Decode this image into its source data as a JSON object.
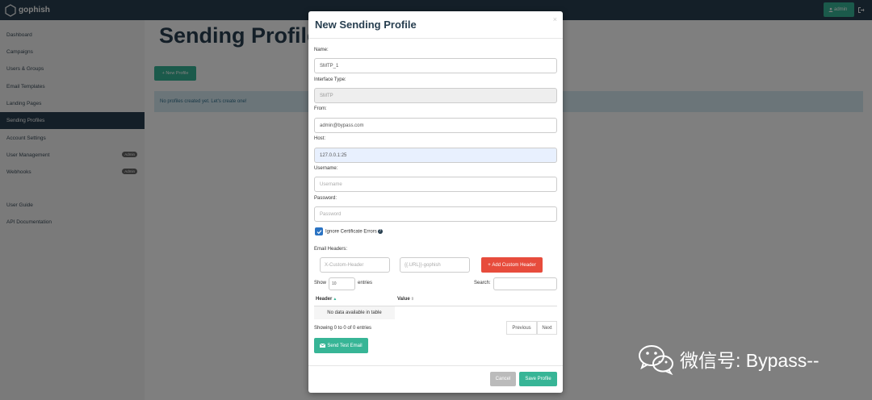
{
  "app": {
    "name": "gophish"
  },
  "header": {
    "user_label": "admin"
  },
  "sidebar": {
    "items": [
      {
        "label": "Dashboard"
      },
      {
        "label": "Campaigns"
      },
      {
        "label": "Users & Groups"
      },
      {
        "label": "Email Templates"
      },
      {
        "label": "Landing Pages"
      },
      {
        "label": "Sending Profiles",
        "active": true
      },
      {
        "label": "Account Settings"
      },
      {
        "label": "User Management",
        "badge": "Admin"
      },
      {
        "label": "Webhooks",
        "badge": "Admin"
      }
    ],
    "bottom_items": [
      {
        "label": "User Guide"
      },
      {
        "label": "API Documentation"
      }
    ]
  },
  "main": {
    "title": "Sending Profiles",
    "new_button": "New Profile",
    "empty_message": "No profiles created yet. Let's create one!"
  },
  "modal": {
    "title": "New Sending Profile",
    "close": "×",
    "name_label": "Name:",
    "name_value": "SMTP_1",
    "interface_label": "Interface Type:",
    "interface_value": "SMTP",
    "from_label": "From:",
    "from_value": "admin@bypass.com",
    "host_label": "Host:",
    "host_value": "127.0.0.1:25",
    "username_label": "Username:",
    "username_placeholder": "Username",
    "password_label": "Password:",
    "password_placeholder": "Password",
    "ignore_cert_label": "Ignore Certificate Errors",
    "ignore_cert_checked": true,
    "help_glyph": "?",
    "headers_label": "Email Headers:",
    "header_key_placeholder": "X-Custom-Header",
    "header_value_placeholder": "{{.URL}}-gophish",
    "add_header_button": "Add Custom Header",
    "show_label": "Show",
    "page_length": "10",
    "entries_label": "entries",
    "search_label": "Search:",
    "table_headers": [
      "Header",
      "Value"
    ],
    "empty_table": "No data available in table",
    "info_text": "Showing 0 to 0 of 0 entries",
    "previous": "Previous",
    "next": "Next",
    "send_test_button": "Send Test Email",
    "cancel_button": "Cancel",
    "save_button": "Save Profile"
  },
  "watermark": {
    "text": "微信号: Bypass--"
  },
  "colors": {
    "navbar": "#283f50",
    "accent": "#37b596",
    "danger": "#e74c3c",
    "checkbox": "#2a73c3"
  }
}
